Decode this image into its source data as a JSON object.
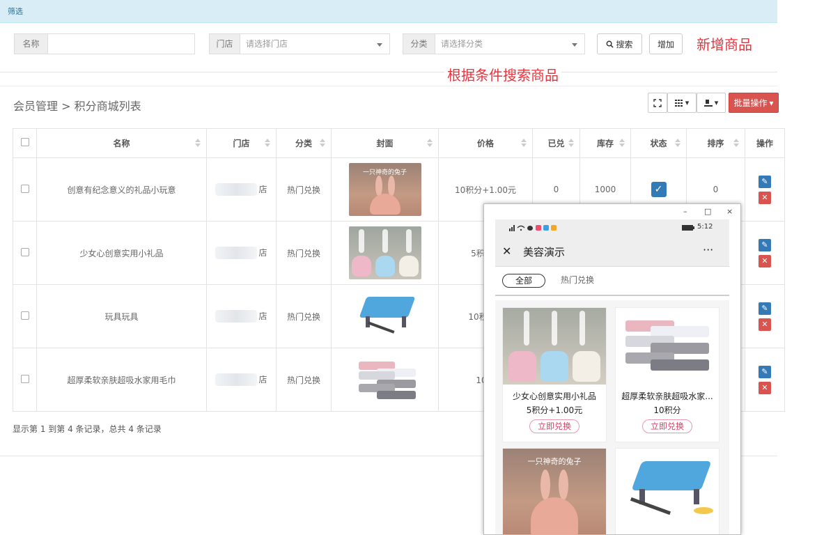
{
  "filter": {
    "label": "筛选"
  },
  "search": {
    "name_label": "名称",
    "name_value": "",
    "store_label": "门店",
    "store_placeholder": "请选择门店",
    "category_label": "分类",
    "category_placeholder": "请选择分类",
    "search_button": "搜索",
    "add_button": "增加"
  },
  "annotations": {
    "add_product": "新增商品",
    "search_by_condition": "根据条件搜索商品"
  },
  "breadcrumb": "会员管理 > 积分商城列表",
  "toolbar": {
    "batch_label": "批量操作"
  },
  "table": {
    "columns": [
      "名称",
      "门店",
      "分类",
      "封面",
      "价格",
      "已兑",
      "库存",
      "状态",
      "排序",
      "操作"
    ],
    "rows": [
      {
        "name": "创意有纪念意义的礼品小玩意",
        "store_suffix": "店",
        "category": "热门兑换",
        "cover_caption": "一只神奇的兔子",
        "price": "10积分+1.00元",
        "redeemed": "0",
        "stock": "1000",
        "sort": "0"
      },
      {
        "name": "少女心创意实用小礼品",
        "store_suffix": "店",
        "category": "热门兑换",
        "price": "5积分+"
      },
      {
        "name": "玩具玩具",
        "store_suffix": "店",
        "category": "热门兑换",
        "price": "10积分+"
      },
      {
        "name": "超厚柔软亲肤超吸水家用毛巾",
        "store_suffix": "店",
        "category": "热门兑换",
        "price": "10积"
      }
    ]
  },
  "footer": {
    "info": "显示第 1 到第 4 条记录，总共 4 条记录"
  },
  "phone": {
    "window_controls": {
      "minimize": "–",
      "maximize": "□",
      "close": "×"
    },
    "status_time": "5:12",
    "nav_close": "✕",
    "nav_title": "美容演示",
    "nav_more": "···",
    "tabs": [
      "全部",
      "热门兑换"
    ],
    "cards": [
      {
        "name": "少女心创意实用小礼品",
        "price": "5积分+1.00元",
        "button": "立即兑换"
      },
      {
        "name": "超厚柔软亲肤超吸水家...",
        "price": "10积分",
        "button": "立即兑换"
      },
      {
        "cover_caption": "一只神奇的兔子"
      }
    ]
  },
  "colors": {
    "filter_bg": "#d9edf7",
    "annotation_red": "#e8343d",
    "batch_red": "#d9534f",
    "primary_blue": "#337ab7"
  }
}
